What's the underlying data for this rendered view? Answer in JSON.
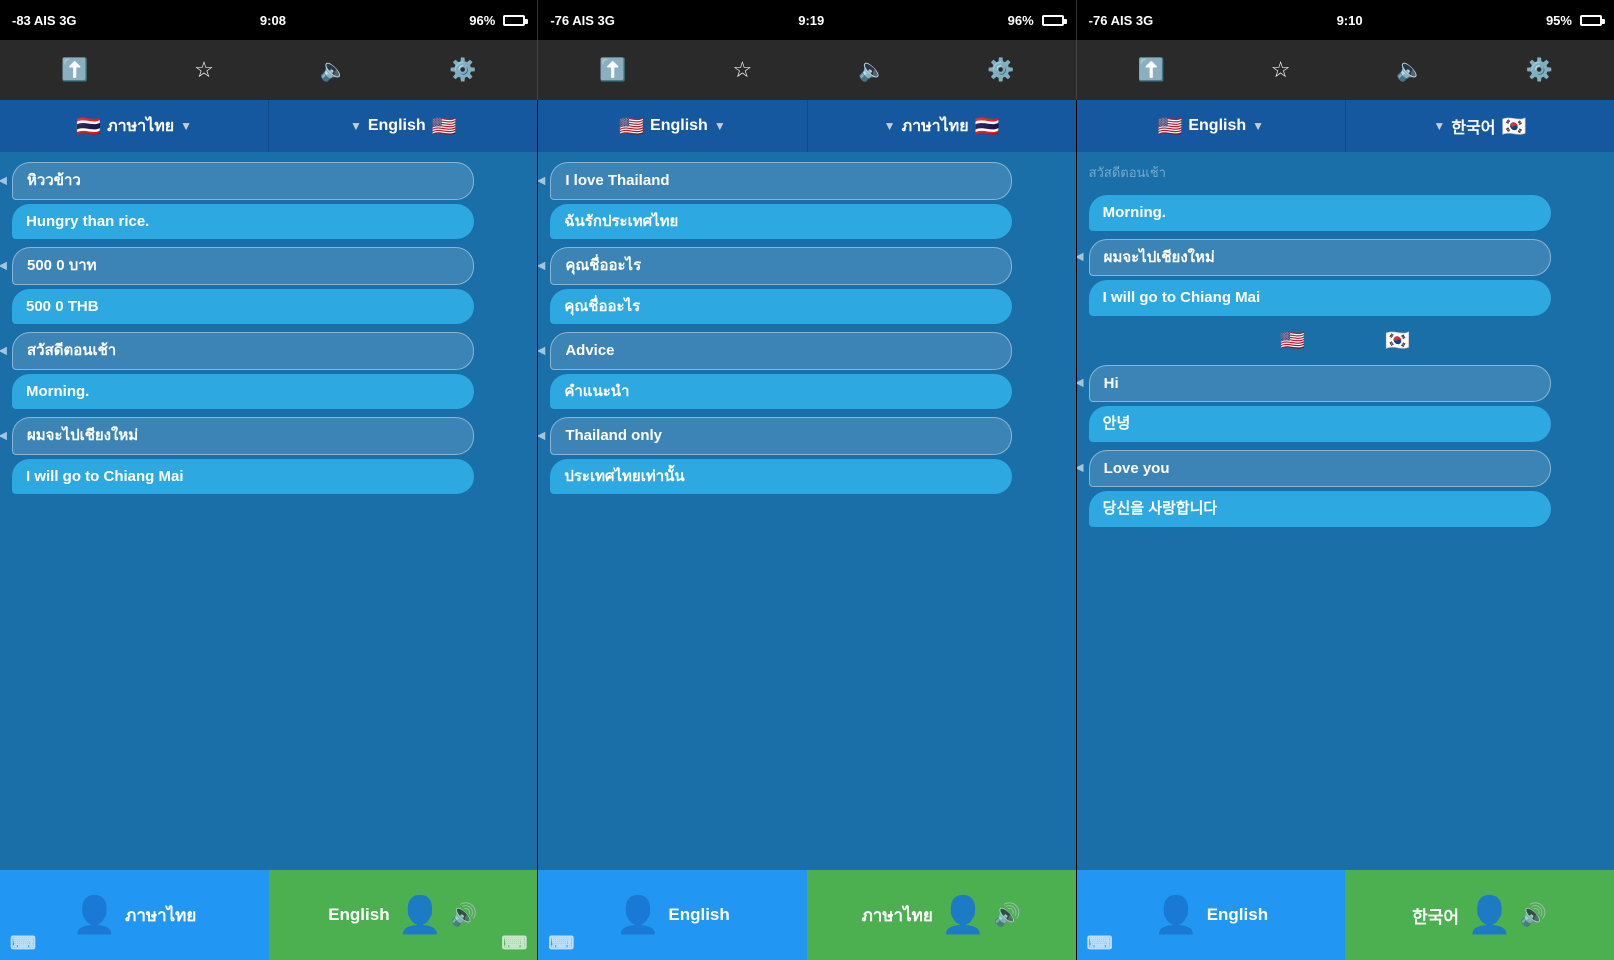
{
  "panels": [
    {
      "id": "panel1",
      "status": {
        "left": "-83 AIS  3G",
        "time": "9:08",
        "battery_pct": "96%"
      },
      "lang_left": {
        "flag": "🇹🇭",
        "label": "ภาษาไทย"
      },
      "lang_right": {
        "flag": "🇺🇸",
        "label": "English"
      },
      "messages": [
        {
          "source": "หิววข้าว",
          "translation": "Hungry than rice."
        },
        {
          "source": "500 0 บาท",
          "translation": "500 0 THB"
        },
        {
          "source": "สวัสดีตอนเช้า",
          "translation": "Morning."
        },
        {
          "source": "ผมจะไปเชียงใหม่",
          "translation": "I will go to Chiang Mai"
        }
      ],
      "bottom_left": {
        "label": "ภาษาไทย",
        "color": "blue"
      },
      "bottom_right": {
        "label": "English",
        "color": "green"
      }
    },
    {
      "id": "panel2",
      "status": {
        "left": "-76 AIS  3G",
        "time": "9:19",
        "battery_pct": "96%"
      },
      "lang_left": {
        "flag": "🇺🇸",
        "label": "English"
      },
      "lang_right": {
        "flag": "🇹🇭",
        "label": "ภาษาไทย"
      },
      "messages": [
        {
          "source": "I love Thailand",
          "translation": "ฉันรักประเทศไทย"
        },
        {
          "source": "คุณชื่ออะไร",
          "translation": "คุณชื่ออะไร"
        },
        {
          "source": "Advice",
          "translation": "คำแนะนำ"
        },
        {
          "source": "Thailand only",
          "translation": "ประเทศไทยเท่านั้น"
        }
      ],
      "bottom_left": {
        "label": "English",
        "color": "blue"
      },
      "bottom_right": {
        "label": "ภาษาไทย",
        "color": "green"
      }
    },
    {
      "id": "panel3",
      "status": {
        "left": "-76 AIS  3G",
        "time": "9:10",
        "battery_pct": "95%"
      },
      "lang_left": {
        "flag": "🇺🇸",
        "label": "English"
      },
      "lang_right": {
        "flag": "🇰🇷",
        "label": "한국어"
      },
      "fade_text": "สวัสดีตอนเช้า",
      "messages": [
        {
          "source": "",
          "translation": "Morning."
        },
        {
          "source": "ผมจะไปเชียงใหม่",
          "translation": "I will go to Chiang Mai"
        },
        {
          "divider": true,
          "flag_left": "🇺🇸",
          "flag_right": "🇰🇷"
        },
        {
          "source": "Hi",
          "translation": "안녕"
        },
        {
          "source": "Love you",
          "translation": "당신을 사랑합니다"
        }
      ],
      "bottom_left": {
        "label": "English",
        "color": "blue"
      },
      "bottom_right": {
        "label": "한국어",
        "color": "green"
      }
    }
  ],
  "toolbar_icons": {
    "share": "↑□",
    "star": "★",
    "speaker": "◀))",
    "settings": "⚙"
  }
}
